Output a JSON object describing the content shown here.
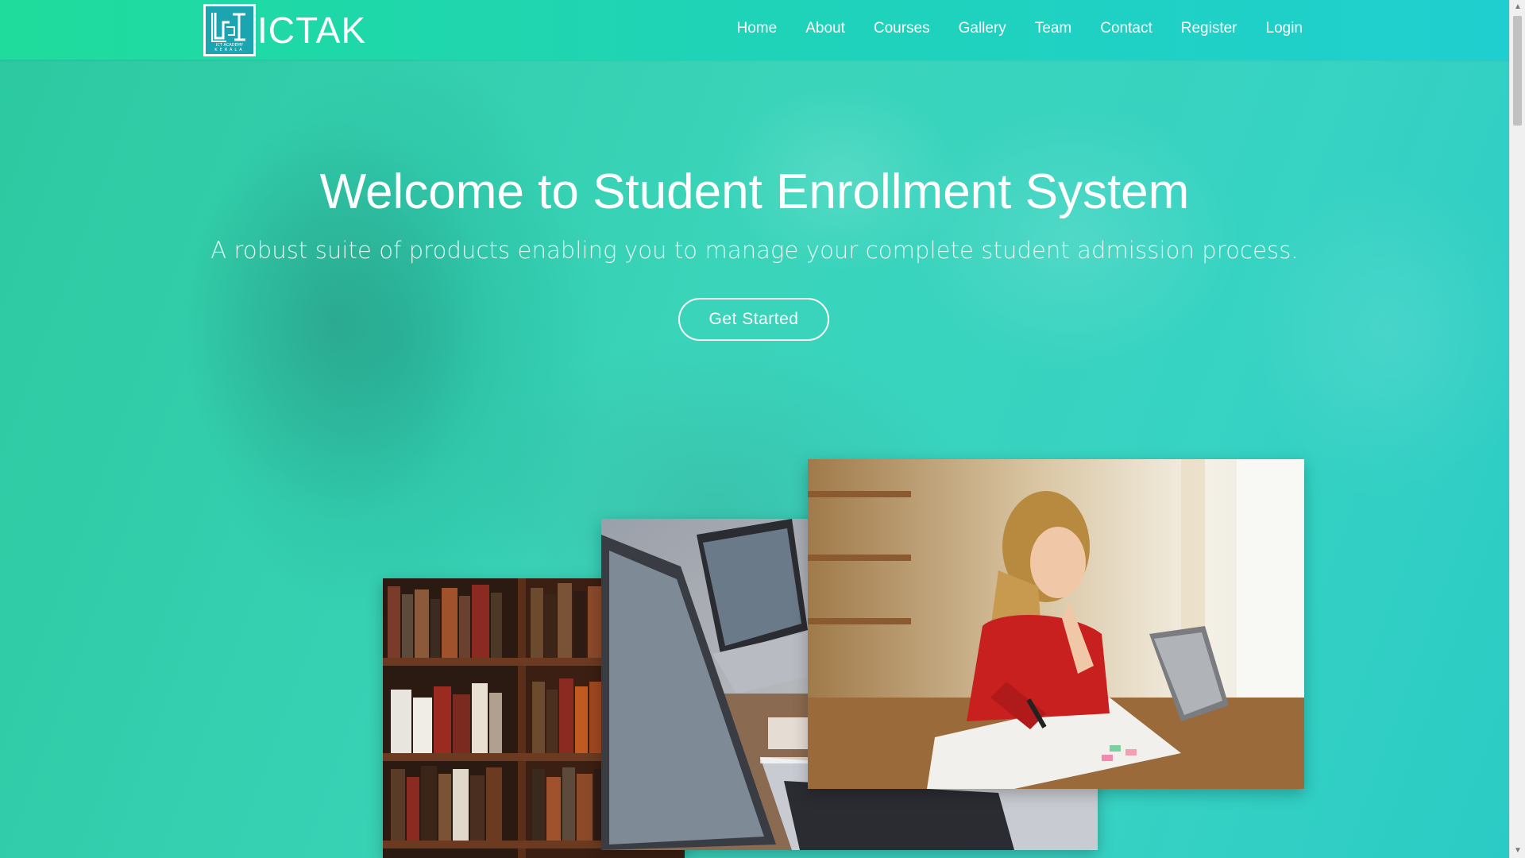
{
  "brand": {
    "name": "ICTAK",
    "logo_text_top": "ICT ACADEMY",
    "logo_text_bottom": "KERALA"
  },
  "nav": {
    "items": [
      {
        "label": "Home"
      },
      {
        "label": "About"
      },
      {
        "label": "Courses"
      },
      {
        "label": "Gallery"
      },
      {
        "label": "Team"
      },
      {
        "label": "Contact"
      },
      {
        "label": "Register"
      },
      {
        "label": "Login"
      }
    ]
  },
  "hero": {
    "title": "Welcome to Student Enrollment System",
    "subtitle": "A robust suite of products enabling you to manage your complete student admission process.",
    "cta_label": "Get Started"
  },
  "colors": {
    "nav_start": "#1fdc9c",
    "nav_end": "#1fcfd0",
    "hero": "#37d3c3",
    "text": "#ffffff"
  },
  "icons": {
    "scroll_up": "chevron-up-icon",
    "scroll_down": "chevron-down-icon"
  }
}
